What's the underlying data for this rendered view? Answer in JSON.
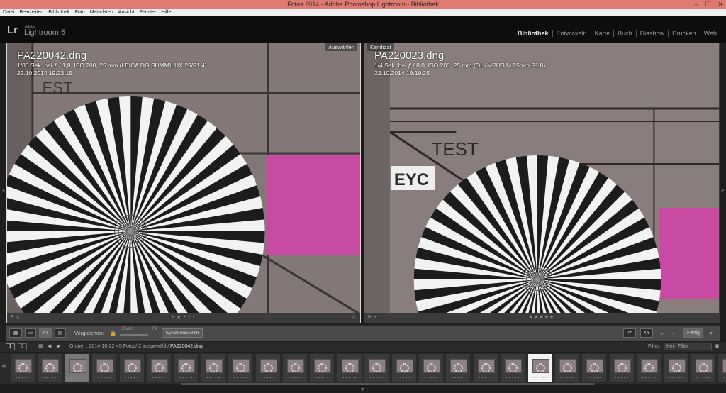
{
  "window": {
    "title": "Fotos 2014 - Adobe Photoshop Lightroom - Bibliothek",
    "buttons": [
      "–",
      "☐",
      "✕"
    ]
  },
  "menu": [
    "Datei",
    "Bearbeiten",
    "Bibliothek",
    "Foto",
    "Metadaten",
    "Ansicht",
    "Fenster",
    "Hilfe"
  ],
  "brand": {
    "logo": "Lr",
    "adobe": "Adobe",
    "product": "Lightroom 5"
  },
  "modules": [
    "Bibliothek",
    "Entwickeln",
    "Karte",
    "Buch",
    "Diashow",
    "Drucken",
    "Web"
  ],
  "active_module": "Bibliothek",
  "left": {
    "tag": "Auswählen",
    "filename": "PA220042.dng",
    "exposure": "1/80 Sek. bei ƒ / 1,8, ISO 200, 25 mm (LEICA DG SUMMILUX 25/F1.4)",
    "datetime": "22.10.2014 19:23:15",
    "chart_text": "EST",
    "stars": "• ★ • • •"
  },
  "right": {
    "tag": "Kandidat",
    "filename": "PA220023.dng",
    "exposure": "1/4 Sek. bei ƒ / 8,0, ISO 200, 25 mm (OLYMPUS M.25mm F1.8)",
    "datetime": "22.10.2014 19:19:25",
    "chart_text": "TEST",
    "chart_label": "EYC",
    "stars": "★★★★★"
  },
  "toolbar": {
    "compare_label": "Vergleichen:",
    "zoom_label": "Zoom",
    "fit_label": "Fit",
    "sync_label": "Synchronisieren",
    "done_label": "Fertig",
    "xy_label": "XY"
  },
  "filmhead": {
    "views": [
      "1",
      "2"
    ],
    "path_prefix": "Ordner : 2014-10-22",
    "count": "45 Fotos/ 2 ausgewählt/",
    "current": "PA220042.dng",
    "filter_label": "Filter:",
    "filter_value": "Kein Filter"
  },
  "filmstrip": {
    "count": 27,
    "selected_index": 2,
    "candidate_index": 19,
    "dots": "• • • • •"
  },
  "colors": {
    "titlebar": "#e07a70",
    "photo_bg": "#7d7272",
    "magenta": "#c94aa2"
  }
}
